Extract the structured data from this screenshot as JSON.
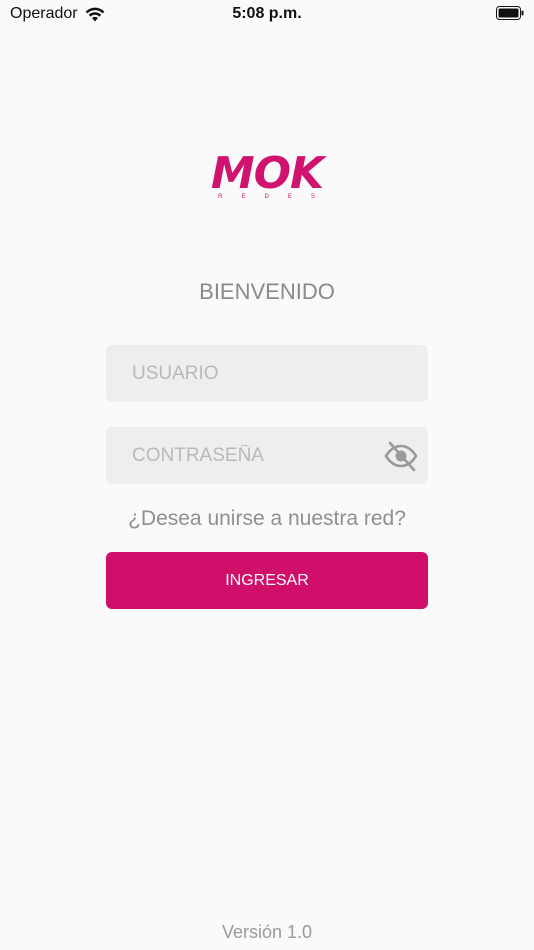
{
  "status_bar": {
    "carrier": "Operador",
    "time": "5:08 p.m.",
    "wifi_icon": "wifi-icon",
    "battery_icon": "battery-icon"
  },
  "logo": {
    "main": "MOK",
    "sub": "REDES"
  },
  "welcome": "BIENVENIDO",
  "form": {
    "username_placeholder": "USUARIO",
    "username_value": "",
    "password_placeholder": "CONTRASEÑA",
    "password_value": "",
    "password_toggle_icon": "eye-slash-icon"
  },
  "join_link": "¿Desea unirse a nuestra red?",
  "login_button": "INGRESAR",
  "version": "Versión 1.0",
  "colors": {
    "brand": "#d0136e",
    "button": "#cf0f6a",
    "field_bg": "#eeeeee",
    "background": "#fafafa"
  }
}
